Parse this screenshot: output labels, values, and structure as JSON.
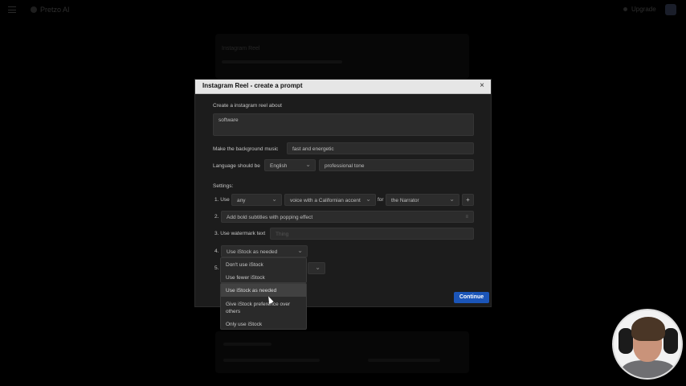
{
  "app": {
    "name": "Pretzo AI",
    "upgrade_label": "Upgrade",
    "background_card_title": "Instagram Reel"
  },
  "modal": {
    "title": "Instagram Reel - create a prompt",
    "close_symbol": "×",
    "topic_label": "Create a instagram reel about",
    "topic_value": "software",
    "music_label": "Make the background music",
    "music_value": "fast and energetic",
    "language_label": "Language should be",
    "language_value": "English",
    "tone_value": "professional tone",
    "settings_label": "Settings:",
    "row1": {
      "label": "1. Use",
      "select1_value": "any",
      "select2_value": "voice with a Californian accent",
      "for_label": "for",
      "select3_value": "the Narrator",
      "add_symbol": "+"
    },
    "row2": {
      "number": "2.",
      "value": "Add bold subtitles with popping effect",
      "handle_symbol": "≡"
    },
    "row3": {
      "label": "3. Use watermark text",
      "placeholder": "Thing"
    },
    "row4": {
      "number": "4.",
      "value": "Use iStock as needed"
    },
    "row5": {
      "number": "5."
    },
    "continue_label": "Continue"
  },
  "dropdown_upper": {
    "items": [
      "Don't use iStock",
      "Use fewer iStock"
    ]
  },
  "dropdown_lower": {
    "selected": "Use iStock as needed",
    "items": [
      "Give iStock preference over",
      "others",
      "Only use iStock"
    ]
  },
  "colors": {
    "accent": "#1b55b8",
    "modal_header": "#e6e6e6",
    "modal_body": "#1c1c1c"
  }
}
